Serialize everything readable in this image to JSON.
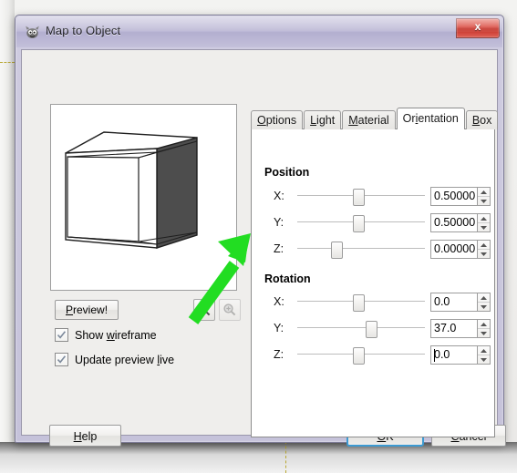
{
  "window": {
    "title": "Map to Object",
    "icon": "wilber-icon",
    "close_label": "x"
  },
  "preview": {
    "button_label": "Preview!",
    "button_mnemonic": "P",
    "zoom_out_icon": "magnifier-minus-icon",
    "zoom_in_icon": "magnifier-plus-icon",
    "object": {
      "type": "cube-wireframe",
      "shaded_face": "right",
      "shade_color": "#4d4d4d",
      "line_color": "#1a1a1a"
    },
    "checkboxes": [
      {
        "label": "Show wireframe",
        "mnemonic": "w",
        "checked": true
      },
      {
        "label": "Update preview live",
        "mnemonic": "l",
        "checked": true
      }
    ]
  },
  "notebook": {
    "tabs": [
      {
        "label": "Options",
        "mnemonic": "O",
        "active": false
      },
      {
        "label": "Light",
        "mnemonic": "L",
        "active": false
      },
      {
        "label": "Material",
        "mnemonic": "M",
        "active": false
      },
      {
        "label": "Orientation",
        "mnemonic": "i",
        "active": true
      },
      {
        "label": "Box",
        "mnemonic": "B",
        "active": false
      }
    ]
  },
  "orientation": {
    "position": {
      "title": "Position",
      "rows": [
        {
          "label": "X:",
          "value": "0.50000",
          "slider_pct": 47,
          "focused": false
        },
        {
          "label": "Y:",
          "value": "0.50000",
          "slider_pct": 47,
          "focused": false
        },
        {
          "label": "Z:",
          "value": "0.00000",
          "slider_pct": 30,
          "focused": false
        }
      ]
    },
    "rotation": {
      "title": "Rotation",
      "rows": [
        {
          "label": "X:",
          "value": "0.0",
          "slider_pct": 47,
          "focused": false
        },
        {
          "label": "Y:",
          "value": "37.0",
          "slider_pct": 57,
          "focused": false
        },
        {
          "label": "Z:",
          "value": "0.0",
          "slider_pct": 47,
          "focused": true
        }
      ]
    }
  },
  "actions": {
    "help": {
      "label": "Help",
      "mnemonic": "H"
    },
    "ok": {
      "label": "OK",
      "mnemonic": "O",
      "is_default": true
    },
    "cancel": {
      "label": "Cancel",
      "mnemonic": "C"
    }
  },
  "annotation": {
    "type": "arrow",
    "color": "#22dd22",
    "points_to": "rotation-y-slider"
  },
  "colors": {
    "titlebar": "#bdb9d6",
    "close_button": "#d9453b",
    "default_button_outline": "#3c9ad2",
    "annotation_green": "#22dd22",
    "guide_yellow": "#b9a832"
  }
}
